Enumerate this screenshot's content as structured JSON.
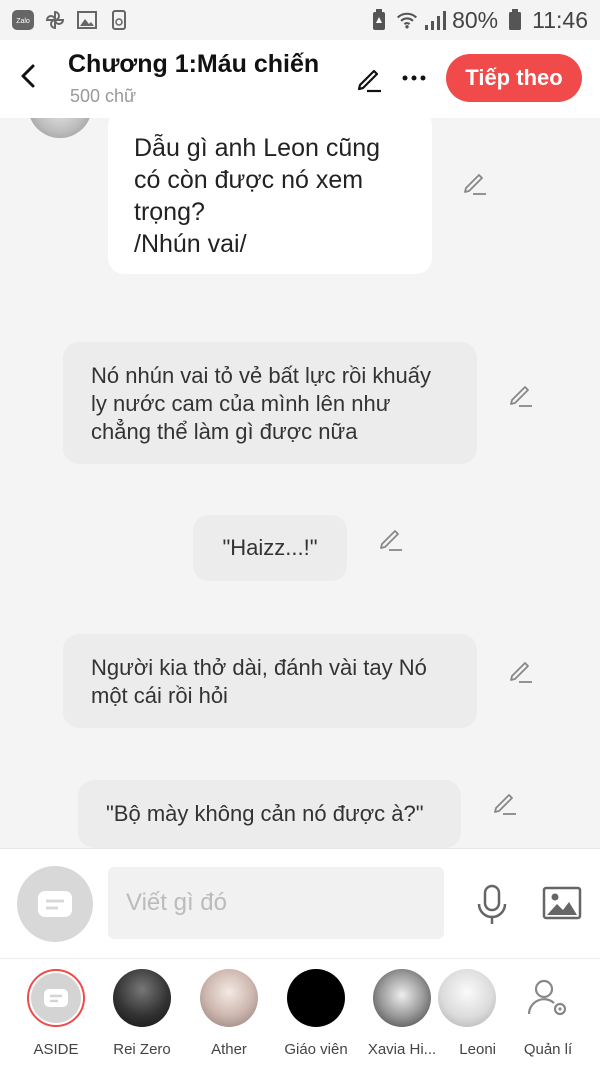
{
  "status_bar": {
    "battery": "80%",
    "time": "11:46",
    "left_icons": [
      "zalo-icon",
      "pinwheel-icon",
      "gallery-icon",
      "app-icon"
    ],
    "right_icons": [
      "battery-saver-icon",
      "wifi-icon",
      "signal-icon",
      "battery-icon"
    ]
  },
  "header": {
    "title": "Chương 1:Máu chiến",
    "subtitle": "500 chữ",
    "next_label": "Tiếp theo",
    "accent": "#f04a4a"
  },
  "messages": [
    {
      "text": "Dẫu gì anh Leon cũng\ncó còn được nó xem\ntrọng?\n/Nhún vai/",
      "style": "character"
    },
    {
      "text": "Nó nhún vai tỏ vẻ bất lực rồi khuấy\nly nước cam của mình lên như\nchẳng thể làm gì được nữa",
      "style": "narration"
    },
    {
      "text": "\"Haizz...!\"",
      "style": "narration"
    },
    {
      "text": "Người kia thở dài, đánh vài tay Nó\nmột cái rồi hỏi",
      "style": "narration"
    },
    {
      "text": "\"Bộ mày không cản nó được à?\"",
      "style": "narration"
    }
  ],
  "composer": {
    "placeholder": "Viết gì đó"
  },
  "characters": [
    {
      "name": "ASIDE",
      "selected": true
    },
    {
      "name": "Rei Zero"
    },
    {
      "name": "Ather"
    },
    {
      "name": "Giáo viên"
    },
    {
      "name": "Xavia Hi..."
    },
    {
      "name": "Leoni"
    },
    {
      "name": "Quản lí"
    }
  ]
}
